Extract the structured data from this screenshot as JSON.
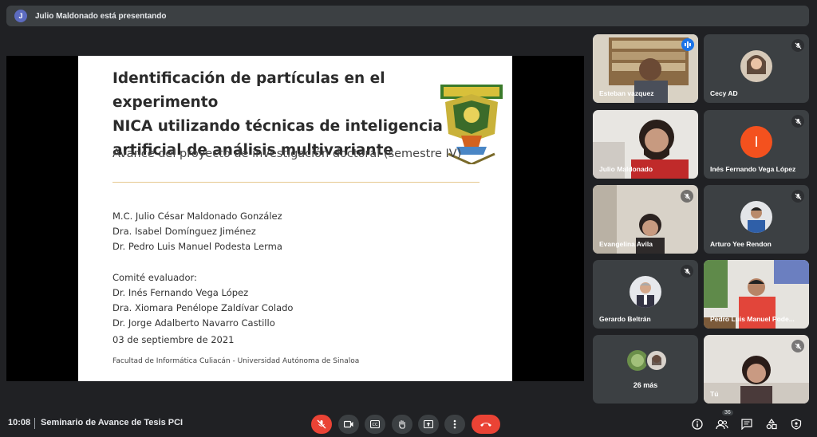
{
  "banner": {
    "avatar_letter": "J",
    "text": "Julio Maldonado está presentando"
  },
  "slide": {
    "title_lines": [
      "Identificación de partículas en el experimento",
      "NICA utilizando técnicas de inteligencia",
      "artificial de análisis multivariante"
    ],
    "subtitle": "Avance del proyecto de investigación doctoral (semestre IV)",
    "authors": [
      "M.C. Julio César Maldonado González",
      "Dra. Isabel Domínguez Jiménez",
      "Dr. Pedro Luis Manuel Podesta Lerma"
    ],
    "committee_label": "Comité evaluador:",
    "committee": [
      "Dr. Inés Fernando Vega López",
      "Dra. Xiomara Penélope Zaldívar Colado",
      "Dr. Jorge Adalberto Navarro Castillo"
    ],
    "date": "03 de septiembre de 2021",
    "footer": "Facultad de Informática Culiacán - Universidad Autónoma de Sinaloa"
  },
  "participants": [
    {
      "name": "Esteban vazquez",
      "state": "speaking"
    },
    {
      "name": "Cecy AD",
      "state": "muted"
    },
    {
      "name": "Julio Maldonado",
      "state": "video"
    },
    {
      "name": "Inés Fernando Vega López",
      "state": "muted",
      "avatar_letter": "I"
    },
    {
      "name": "Evangelina Avila",
      "state": "muted"
    },
    {
      "name": "Arturo Yee Rendon",
      "state": "muted"
    },
    {
      "name": "Gerardo Beltrán",
      "state": "muted"
    },
    {
      "name": "Pedro Luis Manuel Pode...",
      "state": "video"
    },
    {
      "name": "26 más",
      "state": "overflow"
    },
    {
      "name": "Tú",
      "state": "muted"
    }
  ],
  "bottombar": {
    "time": "10:08",
    "meeting_name": "Seminario de Avance de Tesis PCI",
    "people_count": "36",
    "controls": [
      "mic-off-icon",
      "camera-icon",
      "captions-icon",
      "raise-hand-icon",
      "present-icon",
      "more-icon",
      "hangup-icon"
    ],
    "right_icons": [
      "info-icon",
      "people-icon",
      "chat-icon",
      "activities-icon",
      "host-controls-icon"
    ]
  },
  "colors": {
    "accent_red": "#ea4335",
    "speaking_blue": "#1a73e8",
    "bg": "#202124",
    "tile": "#3c4043"
  }
}
